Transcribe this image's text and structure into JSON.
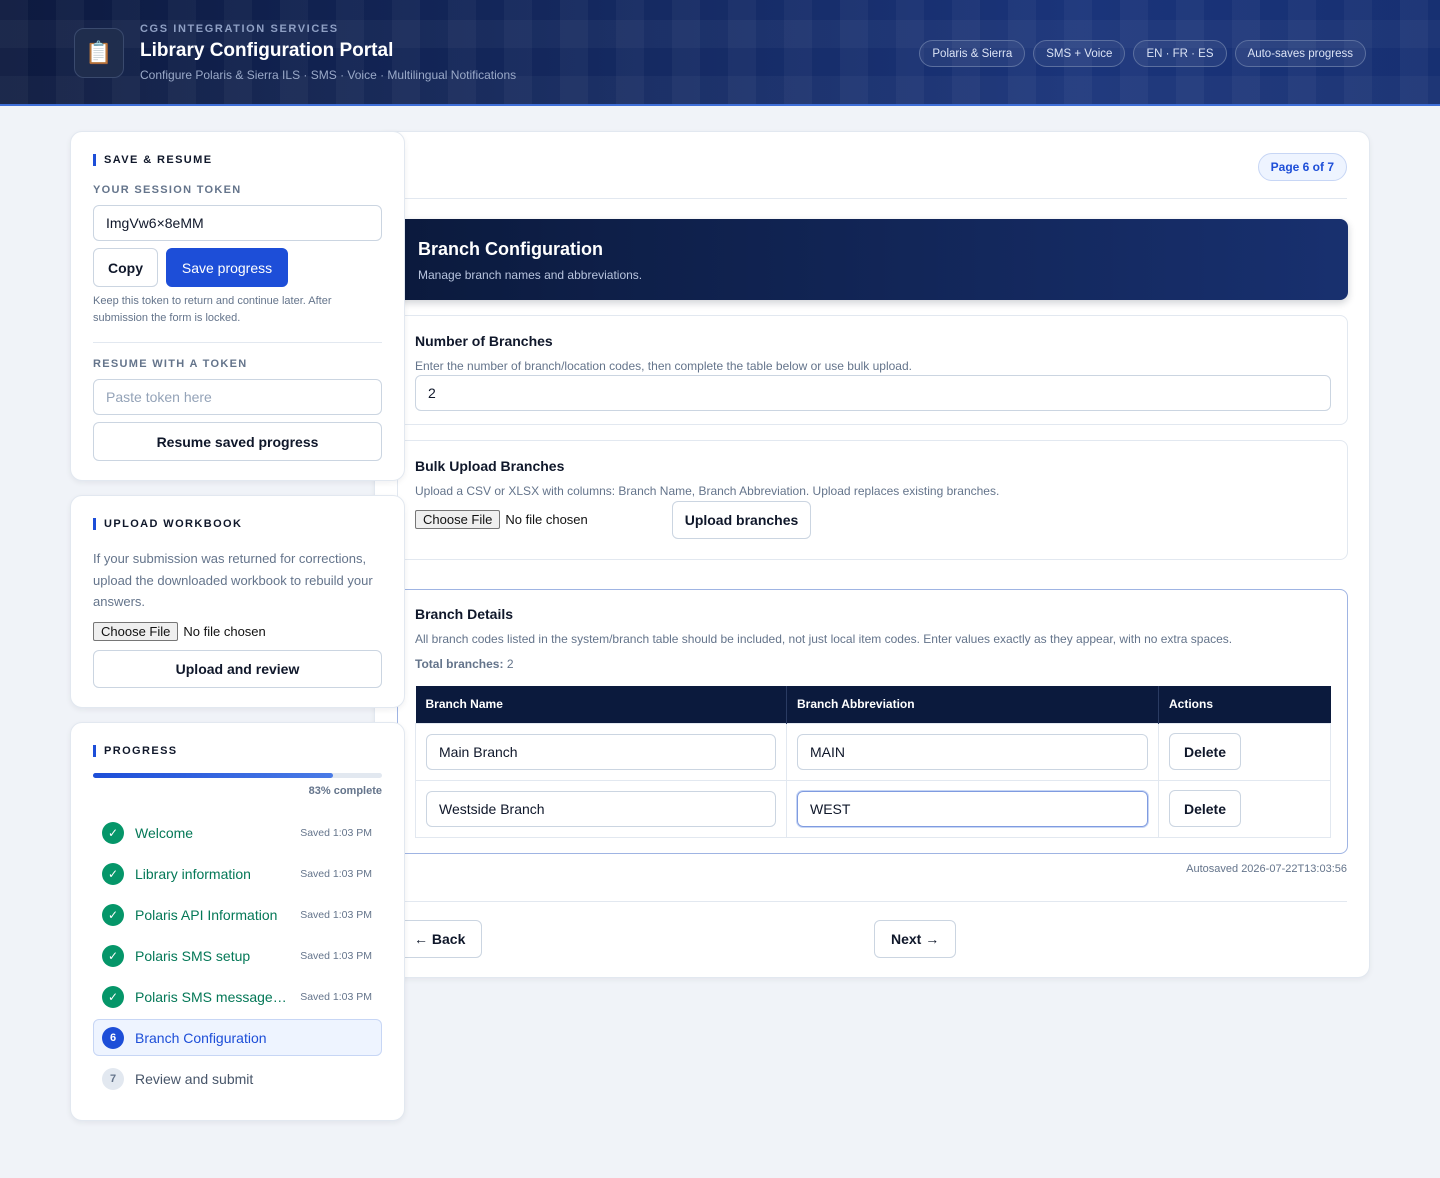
{
  "header": {
    "org": "CGS INTEGRATION SERVICES",
    "title": "Library Configuration Portal",
    "subtitle": "Configure Polaris & Sierra ILS · SMS · Voice · Multilingual Notifications",
    "logo_icon": "clipboard-icon",
    "pills": [
      "Polaris & Sierra",
      "SMS + Voice",
      "EN · FR · ES",
      "Auto-saves progress"
    ]
  },
  "save_resume": {
    "title": "SAVE & RESUME",
    "token_label": "YOUR SESSION TOKEN",
    "token_value": "ImgVw6×8eMM",
    "copy_label": "Copy",
    "save_label": "Save progress",
    "note": "Keep this token to return and continue later. After submission the form is locked.",
    "resume_label": "RESUME WITH A TOKEN",
    "resume_placeholder": "Paste token here",
    "resume_button": "Resume saved progress"
  },
  "upload_workbook": {
    "title": "UPLOAD WORKBOOK",
    "description": "If your submission was returned for corrections, upload the downloaded workbook to rebuild your answers.",
    "choose_file": "Choose File",
    "no_file": "No file chosen",
    "button": "Upload and review"
  },
  "progress": {
    "title": "PROGRESS",
    "percent": 83,
    "percent_label": "83% complete",
    "steps": [
      {
        "num": "1",
        "name": "Welcome",
        "status": "done",
        "saved": "Saved 1:03 PM"
      },
      {
        "num": "2",
        "name": "Library information",
        "status": "done",
        "saved": "Saved 1:03 PM"
      },
      {
        "num": "3",
        "name": "Polaris API Information",
        "status": "done",
        "saved": "Saved 1:03 PM"
      },
      {
        "num": "4",
        "name": "Polaris SMS setup",
        "status": "done",
        "saved": "Saved 1:03 PM"
      },
      {
        "num": "5",
        "name": "Polaris SMS messages ...",
        "status": "done",
        "saved": "Saved 1:03 PM"
      },
      {
        "num": "6",
        "name": "Branch Configuration",
        "status": "active",
        "saved": ""
      },
      {
        "num": "7",
        "name": "Review and submit",
        "status": "todo",
        "saved": ""
      }
    ]
  },
  "main": {
    "page_badge": "Page 6 of 7",
    "hero_title": "Branch Configuration",
    "hero_subtitle": "Manage branch names and abbreviations.",
    "num_branches": {
      "title": "Number of Branches",
      "description": "Enter the number of branch/location codes, then complete the table below or use bulk upload.",
      "value": "2"
    },
    "bulk_upload": {
      "title": "Bulk Upload Branches",
      "description": "Upload a CSV or XLSX with columns: Branch Name, Branch Abbreviation. Upload replaces existing branches.",
      "choose_file": "Choose File",
      "no_file": "No file chosen",
      "button": "Upload branches"
    },
    "branch_details": {
      "title": "Branch Details",
      "description": "All branch codes listed in the system/branch table should be included, not just local item codes. Enter values exactly as they appear, with no extra spaces.",
      "total_label": "Total branches:",
      "total_value": "2",
      "columns": [
        "Branch Name",
        "Branch Abbreviation",
        "Actions"
      ],
      "rows": [
        {
          "name": "Main Branch",
          "abbr": "MAIN",
          "action": "Delete"
        },
        {
          "name": "Westside Branch",
          "abbr": "WEST",
          "action": "Delete"
        }
      ]
    },
    "autosave": "Autosaved 2026-07-22T13:03:56",
    "back_label": "← Back",
    "next_label": "Next →"
  }
}
